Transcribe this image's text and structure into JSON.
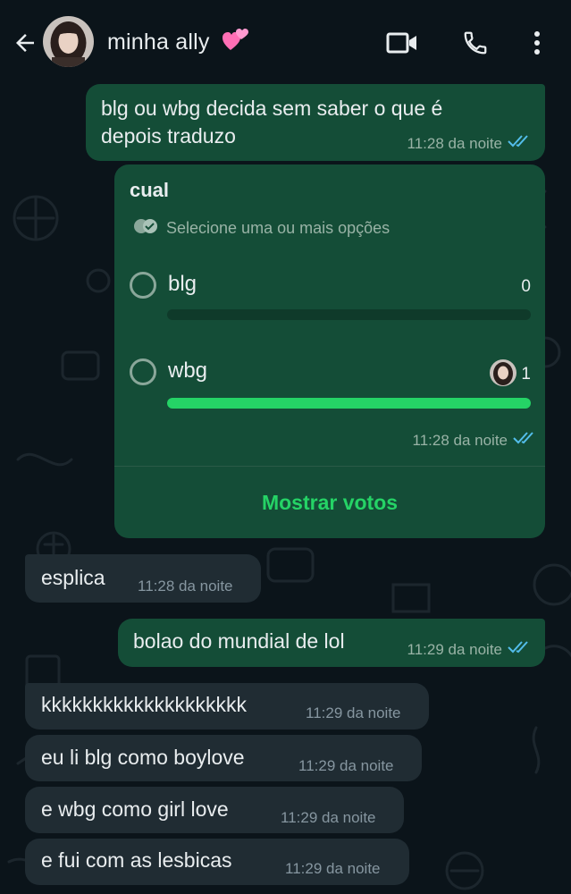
{
  "header": {
    "contact_name": "minha ally",
    "emoji_icon": "two-hearts-icon",
    "accent_color": "#ff8fc8"
  },
  "messages": [
    {
      "id": "m1",
      "direction": "outgoing",
      "lines": [
        "blg ou wbg decida sem saber o que é",
        "depois traduzo"
      ],
      "time": "11:28 da noite",
      "status": "read"
    },
    {
      "id": "m3",
      "direction": "incoming",
      "text": "esplica",
      "time": "11:28 da noite"
    },
    {
      "id": "m4",
      "direction": "outgoing",
      "text": "bolao do mundial de lol",
      "time": "11:29 da noite",
      "status": "read"
    },
    {
      "id": "m5",
      "direction": "incoming",
      "text": "kkkkkkkkkkkkkkkkkkkk",
      "time": "11:29 da noite"
    },
    {
      "id": "m6",
      "direction": "incoming",
      "text": "eu li blg como boylove",
      "time": "11:29 da noite"
    },
    {
      "id": "m7",
      "direction": "incoming",
      "text": "e wbg como girl love",
      "time": "11:29 da noite"
    },
    {
      "id": "m8",
      "direction": "incoming",
      "text": "e fui com as lesbicas",
      "time": "11:29 da noite"
    }
  ],
  "poll": {
    "question": "cual",
    "hint": "Selecione uma ou mais opções",
    "options": [
      {
        "label": "blg",
        "votes": "0",
        "share": 0
      },
      {
        "label": "wbg",
        "votes": "1",
        "share": 1
      }
    ],
    "time": "11:28 da noite",
    "status": "read",
    "view_votes_label": "Mostrar votos"
  },
  "colors": {
    "outgoing_bubble": "#144d37",
    "incoming_bubble": "#202c33",
    "read_ticks": "#53bdeb",
    "poll_fill": "#25d366"
  }
}
